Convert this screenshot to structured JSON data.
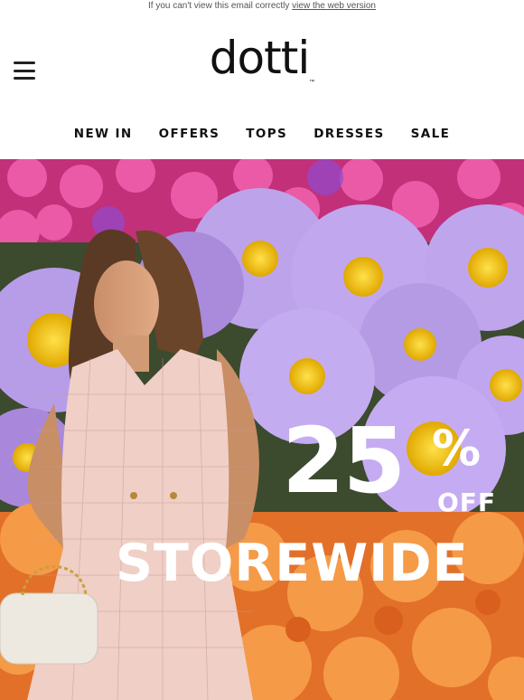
{
  "preheader": {
    "text": "If you can't view this email correctly",
    "link_label": "view the web version"
  },
  "header": {
    "menu_icon": "hamburger-menu-icon",
    "logo_text": "dotti",
    "logo_tm": "™"
  },
  "nav": {
    "items": [
      {
        "label": "NEW IN"
      },
      {
        "label": "OFFERS"
      },
      {
        "label": "TOPS"
      },
      {
        "label": "DRESSES"
      },
      {
        "label": "SALE"
      }
    ]
  },
  "hero": {
    "discount_number": "25",
    "discount_symbol": "%",
    "discount_off": "OFF",
    "headline": "STOREWIDE",
    "colors": {
      "pink_flowers": "#e0408f",
      "purple_flowers": "#b69be6",
      "orange_flowers": "#f2843a",
      "flower_center": "#f4c20d",
      "text": "#ffffff"
    }
  }
}
